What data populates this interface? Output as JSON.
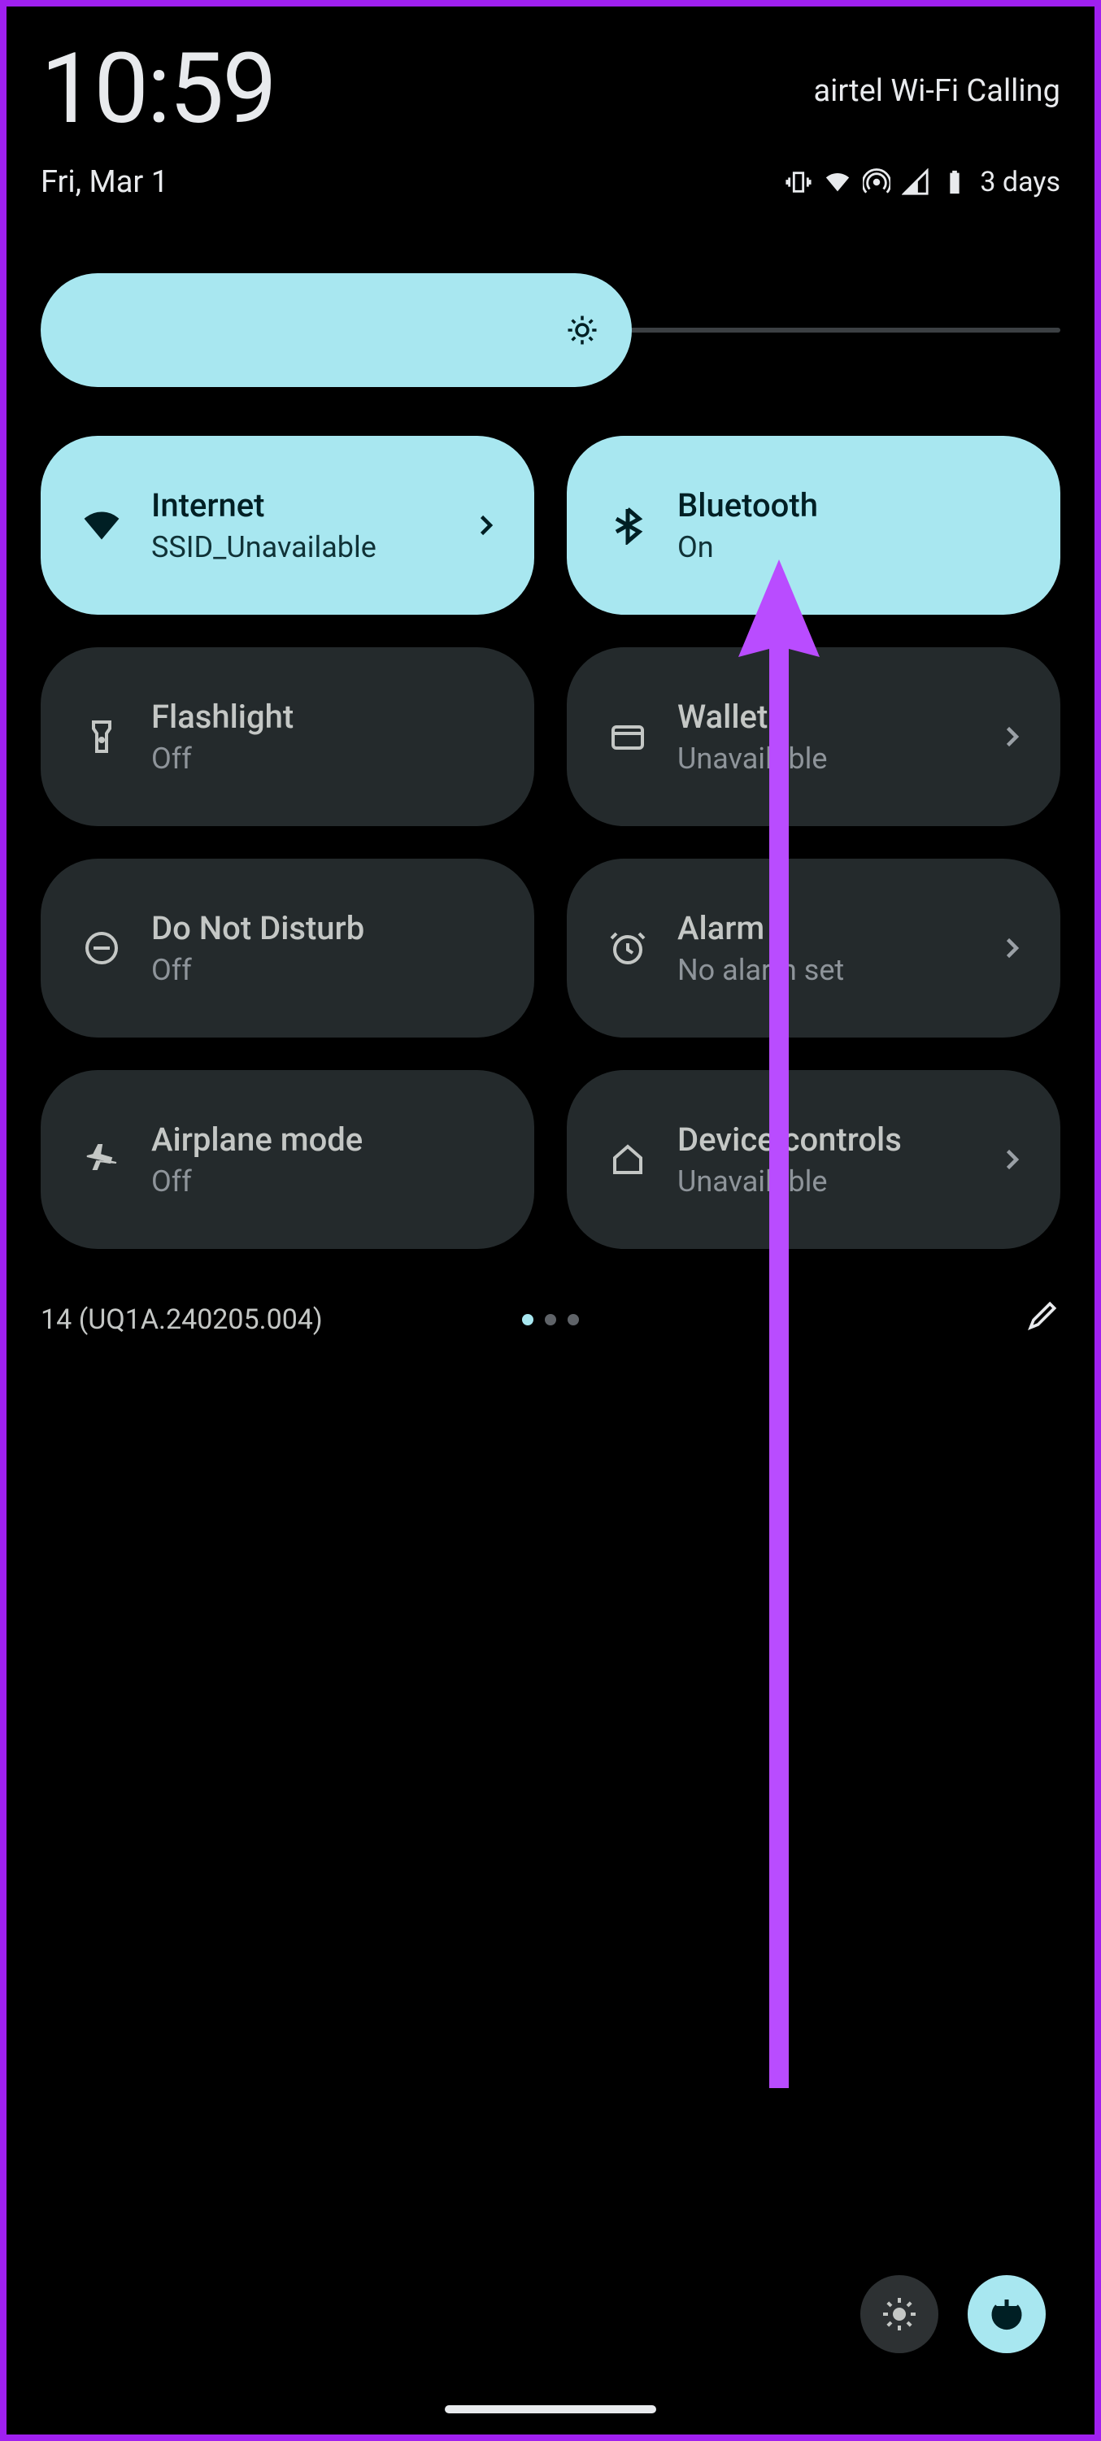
{
  "status": {
    "time": "10:59",
    "date": "Fri, Mar 1",
    "carrier": "airtel Wi-Fi Calling",
    "battery_label": "3 days"
  },
  "brightness": {
    "percent": 58
  },
  "tiles": {
    "internet": {
      "title": "Internet",
      "sub": "SSID_Unavailable",
      "chevron": true
    },
    "bluetooth": {
      "title": "Bluetooth",
      "sub": "On",
      "chevron": false
    },
    "flash": {
      "title": "Flashlight",
      "sub": "Off",
      "chevron": false
    },
    "wallet": {
      "title": "Wallet",
      "sub": "Unavailable",
      "chevron": true
    },
    "dnd": {
      "title": "Do Not Disturb",
      "sub": "Off",
      "chevron": false
    },
    "alarm": {
      "title": "Alarm",
      "sub": "No alarm set",
      "chevron": true
    },
    "airplane": {
      "title": "Airplane mode",
      "sub": "Off",
      "chevron": false
    },
    "devctrl": {
      "title": "Device controls",
      "sub": "Unavailable",
      "chevron": true
    }
  },
  "footer": {
    "build": "14 (UQ1A.240205.004)",
    "page_count": 3,
    "active_page": 0
  },
  "annotation": {
    "arrow_target": "bluetooth-tile",
    "color": "#b94cff"
  }
}
